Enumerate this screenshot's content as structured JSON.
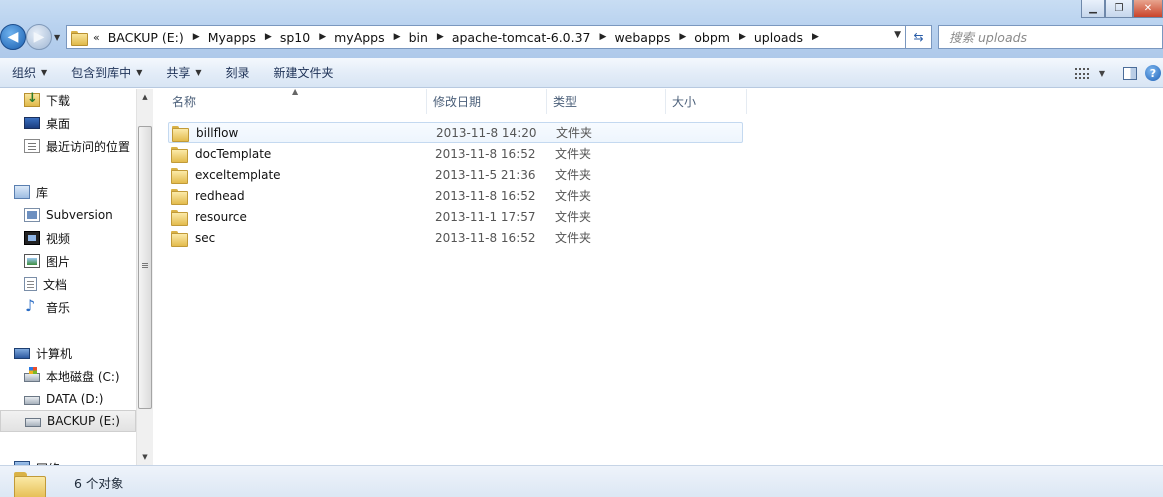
{
  "address": {
    "overflow_chevron": "«",
    "crumbs": [
      "BACKUP (E:)",
      "Myapps",
      "sp10",
      "myApps",
      "bin",
      "apache-tomcat-6.0.37",
      "webapps",
      "obpm",
      "uploads"
    ]
  },
  "search": {
    "placeholder": "搜索 uploads"
  },
  "toolbar": {
    "organize": "组织",
    "include_in_library": "包含到库中",
    "share": "共享",
    "burn": "刻录",
    "new_folder": "新建文件夹"
  },
  "nav": {
    "favorites": [
      {
        "label": "下载",
        "icon": "download-folder-icon"
      },
      {
        "label": "桌面",
        "icon": "desktop-icon"
      },
      {
        "label": "最近访问的位置",
        "icon": "recent-places-icon"
      }
    ],
    "libraries": {
      "label": "库",
      "items": [
        {
          "label": "Subversion",
          "icon": "subversion-icon"
        },
        {
          "label": "视频",
          "icon": "video-icon"
        },
        {
          "label": "图片",
          "icon": "pictures-icon"
        },
        {
          "label": "文档",
          "icon": "documents-icon"
        },
        {
          "label": "音乐",
          "icon": "music-icon"
        }
      ]
    },
    "computer": {
      "label": "计算机",
      "items": [
        {
          "label": "本地磁盘 (C:)",
          "icon": "system-drive-icon"
        },
        {
          "label": "DATA (D:)",
          "icon": "drive-icon"
        },
        {
          "label": "BACKUP (E:)",
          "icon": "drive-icon"
        }
      ]
    },
    "network": {
      "label": "网络",
      "icon": "network-icon"
    }
  },
  "columns": {
    "name": "名称",
    "modified": "修改日期",
    "type": "类型",
    "size": "大小"
  },
  "files": [
    {
      "name": "billflow",
      "modified": "2013-11-8 14:20",
      "type": "文件夹"
    },
    {
      "name": "docTemplate",
      "modified": "2013-11-8 16:52",
      "type": "文件夹"
    },
    {
      "name": "exceltemplate",
      "modified": "2013-11-5 21:36",
      "type": "文件夹"
    },
    {
      "name": "redhead",
      "modified": "2013-11-8 16:52",
      "type": "文件夹"
    },
    {
      "name": "resource",
      "modified": "2013-11-1 17:57",
      "type": "文件夹"
    },
    {
      "name": "sec",
      "modified": "2013-11-8 16:52",
      "type": "文件夹"
    }
  ],
  "status": {
    "count_text": "6 个对象"
  },
  "colors": {
    "accent": "#1a5fb0",
    "folder": "#e3bb4d",
    "toolbar_text": "#1e3257"
  }
}
